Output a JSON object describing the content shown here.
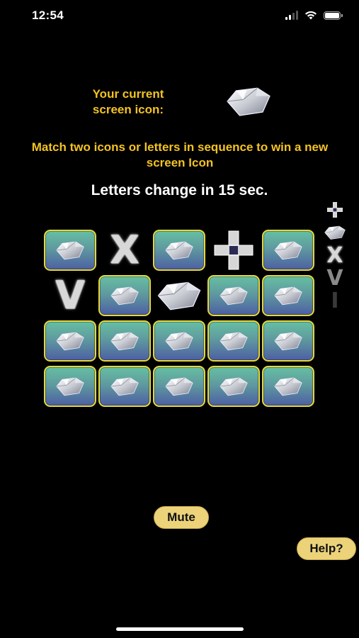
{
  "status_bar": {
    "time": "12:54",
    "icons": [
      "cellular-signal-icon",
      "wifi-icon",
      "battery-icon"
    ]
  },
  "header": {
    "current_icon_label": "Your current screen icon:",
    "current_icon": "diamond-icon",
    "instructions": "Match two icons or letters in sequence to win a new screen Icon",
    "timer_text": "Letters change in 15 sec."
  },
  "sequence_column": [
    {
      "kind": "letter",
      "value": "+",
      "state": "active"
    },
    {
      "kind": "icon",
      "value": "diamond-icon",
      "state": "active"
    },
    {
      "kind": "letter",
      "value": "X",
      "state": "active"
    },
    {
      "kind": "letter",
      "value": "V",
      "state": "fade1"
    },
    {
      "kind": "letter",
      "value": "I",
      "state": "fade2"
    }
  ],
  "board": {
    "rows": 4,
    "cols": 5,
    "cells": [
      [
        {
          "state": "hidden"
        },
        {
          "state": "revealed",
          "kind": "letter",
          "value": "X"
        },
        {
          "state": "hidden"
        },
        {
          "state": "revealed",
          "kind": "letter",
          "value": "+"
        },
        {
          "state": "hidden"
        }
      ],
      [
        {
          "state": "revealed",
          "kind": "letter",
          "value": "V"
        },
        {
          "state": "hidden"
        },
        {
          "state": "revealed",
          "kind": "icon",
          "value": "diamond-icon"
        },
        {
          "state": "hidden"
        },
        {
          "state": "hidden"
        }
      ],
      [
        {
          "state": "hidden"
        },
        {
          "state": "hidden"
        },
        {
          "state": "hidden"
        },
        {
          "state": "hidden"
        },
        {
          "state": "hidden"
        }
      ],
      [
        {
          "state": "hidden"
        },
        {
          "state": "hidden"
        },
        {
          "state": "hidden"
        },
        {
          "state": "hidden"
        },
        {
          "state": "hidden"
        }
      ]
    ]
  },
  "buttons": {
    "mute_label": "Mute",
    "help_label": "Help?"
  },
  "colors": {
    "background": "#000000",
    "gold_text": "#f3c323",
    "button_fill": "#ecd37a",
    "tile_border": "#e6d93a"
  }
}
